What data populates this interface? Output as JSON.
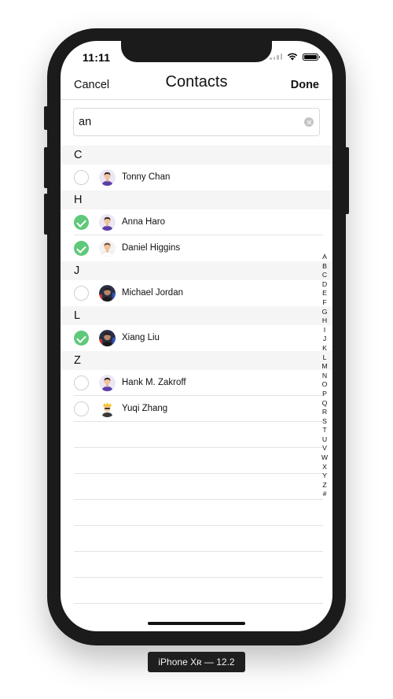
{
  "status_bar": {
    "time": "11:11"
  },
  "navbar": {
    "cancel_label": "Cancel",
    "title": "Contacts",
    "done_label": "Done"
  },
  "search": {
    "value": "an"
  },
  "sections": [
    {
      "letter": "C",
      "contacts": [
        {
          "name": "Tonny Chan",
          "selected": false,
          "avatar": "purple-shirt-avatar"
        }
      ]
    },
    {
      "letter": "H",
      "contacts": [
        {
          "name": "Anna Haro",
          "selected": true,
          "avatar": "purple-shirt-avatar"
        },
        {
          "name": "Daniel Higgins",
          "selected": true,
          "avatar": "white-shirt-avatar"
        }
      ]
    },
    {
      "letter": "J",
      "contacts": [
        {
          "name": "Michael Jordan",
          "selected": false,
          "avatar": "photo-avatar"
        }
      ]
    },
    {
      "letter": "L",
      "contacts": [
        {
          "name": "Xiang Liu",
          "selected": true,
          "avatar": "photo-avatar"
        }
      ]
    },
    {
      "letter": "Z",
      "contacts": [
        {
          "name": "Hank M. Zakroff",
          "selected": false,
          "avatar": "purple-shirt-avatar"
        },
        {
          "name": "Yuqi Zhang",
          "selected": false,
          "avatar": "cartoon-avatar"
        }
      ]
    }
  ],
  "index_letters": [
    "A",
    "B",
    "C",
    "D",
    "E",
    "F",
    "G",
    "H",
    "I",
    "J",
    "K",
    "L",
    "M",
    "N",
    "O",
    "P",
    "Q",
    "R",
    "S",
    "T",
    "U",
    "V",
    "W",
    "X",
    "Y",
    "Z",
    "#"
  ],
  "device_label": "iPhone Xʀ — 12.2",
  "colors": {
    "check_green": "#5ec97a",
    "section_bg": "#f5f5f5",
    "separator": "#e3e3e3"
  }
}
